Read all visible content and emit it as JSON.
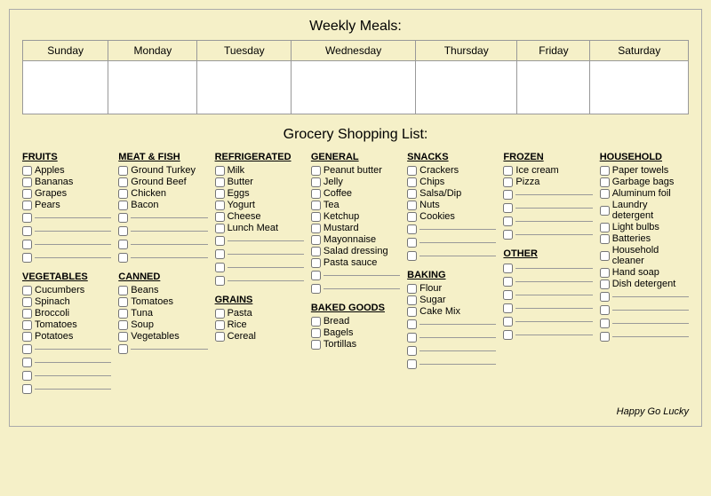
{
  "weekly": {
    "title": "Weekly Meals:",
    "days": [
      "Sunday",
      "Monday",
      "Tuesday",
      "Wednesday",
      "Thursday",
      "Friday",
      "Saturday"
    ]
  },
  "grocery": {
    "title": "Grocery Shopping List:",
    "columns": [
      {
        "sections": [
          {
            "title": "FRUITS",
            "items": [
              "Apples",
              "Bananas",
              "Grapes",
              "Pears"
            ],
            "blanks": 4
          },
          {
            "title": "VEGETABLES",
            "items": [
              "Cucumbers",
              "Spinach",
              "Broccoli",
              "Tomatoes",
              "Potatoes"
            ],
            "blanks": 4
          }
        ]
      },
      {
        "sections": [
          {
            "title": "MEAT & FISH",
            "items": [
              "Ground Turkey",
              "Ground Beef",
              "Chicken",
              "Bacon"
            ],
            "blanks": 4
          },
          {
            "title": "CANNED",
            "items": [
              "Beans",
              "Tomatoes",
              "Tuna",
              "Soup",
              "Vegetables"
            ],
            "blanks": 1
          }
        ]
      },
      {
        "sections": [
          {
            "title": "REFRIGERATED",
            "items": [
              "Milk",
              "Butter",
              "Eggs",
              "Yogurt",
              "Cheese",
              "Lunch Meat"
            ],
            "blanks": 4
          },
          {
            "title": "GRAINS",
            "items": [
              "Pasta",
              "Rice",
              "Cereal"
            ],
            "blanks": 0
          }
        ]
      },
      {
        "sections": [
          {
            "title": "GENERAL",
            "items": [
              "Peanut butter",
              "Jelly",
              "Coffee",
              "Tea",
              "Ketchup",
              "Mustard",
              "Mayonnaise",
              "Salad dressing",
              "Pasta sauce"
            ],
            "blanks": 2
          },
          {
            "title": "BAKED GOODS",
            "items": [
              "Bread",
              "Bagels",
              "Tortillas"
            ],
            "blanks": 0
          }
        ]
      },
      {
        "sections": [
          {
            "title": "SNACKS",
            "items": [
              "Crackers",
              "Chips",
              "Salsa/Dip",
              "Nuts",
              "Cookies"
            ],
            "blanks": 3
          },
          {
            "title": "BAKING",
            "items": [
              "Flour",
              "Sugar",
              "Cake Mix"
            ],
            "blanks": 4
          }
        ]
      },
      {
        "sections": [
          {
            "title": "FROZEN",
            "items": [
              "Ice cream",
              "Pizza"
            ],
            "blanks": 4
          },
          {
            "title": "OTHER",
            "items": [],
            "blanks": 6
          }
        ]
      },
      {
        "sections": [
          {
            "title": "HOUSEHOLD",
            "items": [
              "Paper towels",
              "Garbage bags",
              "Aluminum foil",
              "Laundry detergent",
              "Light bulbs",
              "Batteries",
              "Household cleaner",
              "Hand soap",
              "Dish detergent"
            ],
            "blanks": 4
          }
        ]
      }
    ]
  },
  "footer": {
    "text": "Happy Go Lucky"
  }
}
